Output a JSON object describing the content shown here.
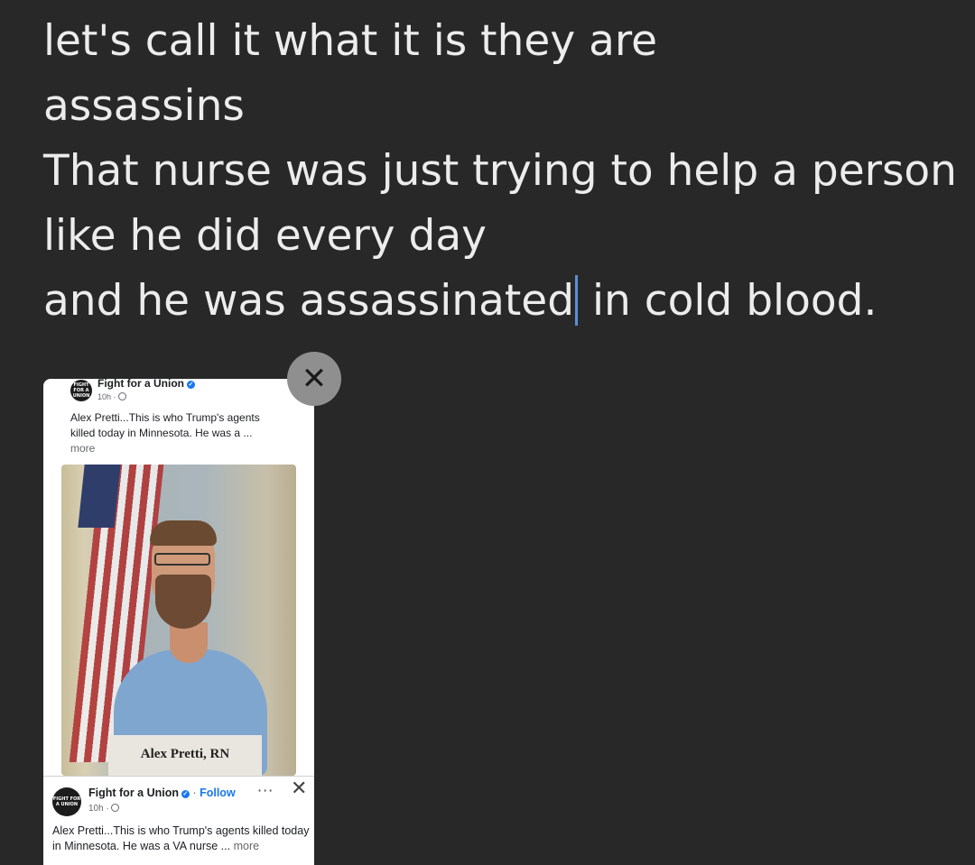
{
  "compose": {
    "lines": [
      "let's call it what it is they are",
      "assassins",
      "That nurse was just trying to help a person",
      "like he did every day"
    ],
    "last_line_before_caret": "and he was assassinated",
    "last_line_after_caret": " in cold blood."
  },
  "attachment": {
    "remove_icon": "close-icon",
    "remove_glyph": "✕",
    "post_top": {
      "page_name": "Fight for a Union",
      "avatar_text": "FIGHT FOR A UNION",
      "time": "10h ·",
      "caption": "Alex Pretti...This is who Trump's agents killed today in Minnesota. He was a ...",
      "more": "more"
    },
    "photo": {
      "nameplate": "Alex Pretti, RN"
    },
    "post_bottom": {
      "page_name": "Fight for a Union",
      "follow_sep": " · ",
      "follow": "Follow",
      "time": "10h ·",
      "menu_glyph": "···",
      "close_glyph": "✕",
      "caption": "Alex Pretti...This is who Trump's agents killed today in Minnesota. He was a VA nurse ...",
      "more": "more"
    }
  },
  "colors": {
    "background": "#282828",
    "text": "#ececec",
    "caret": "#5b8fd6",
    "facebook_blue": "#1877f2"
  }
}
